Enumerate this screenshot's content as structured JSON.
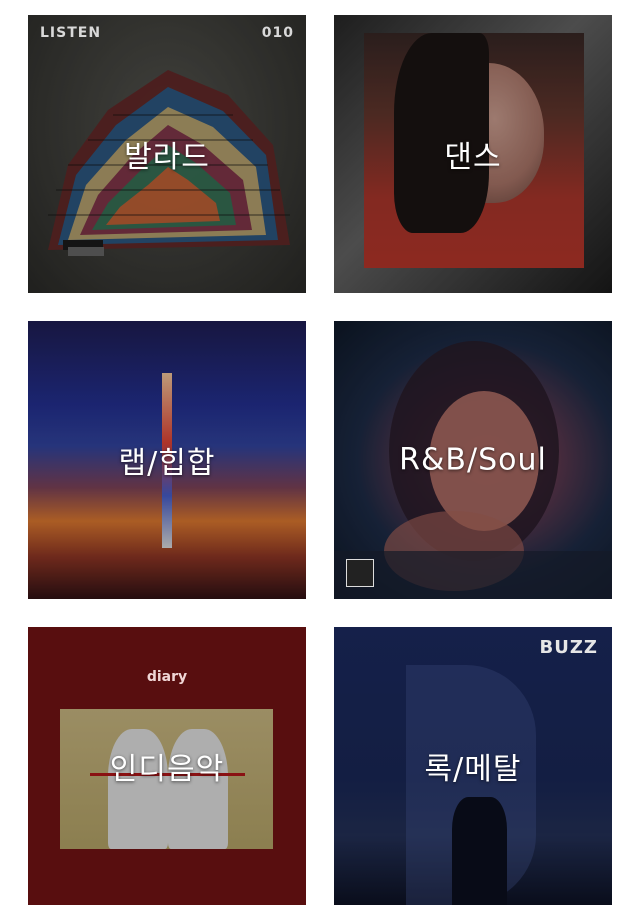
{
  "genres": [
    {
      "id": "ballad",
      "label": "발라드",
      "cover_text_left": "LISTEN",
      "cover_text_right": "010"
    },
    {
      "id": "dance",
      "label": "댄스"
    },
    {
      "id": "rap-hiphop",
      "label": "랩/힙합"
    },
    {
      "id": "rnb-soul",
      "label": "R&B/Soul"
    },
    {
      "id": "indie",
      "label": "인디음악",
      "cover_title": "diary"
    },
    {
      "id": "rock-metal",
      "label": "록/메탈",
      "cover_title": "BUZZ"
    }
  ]
}
